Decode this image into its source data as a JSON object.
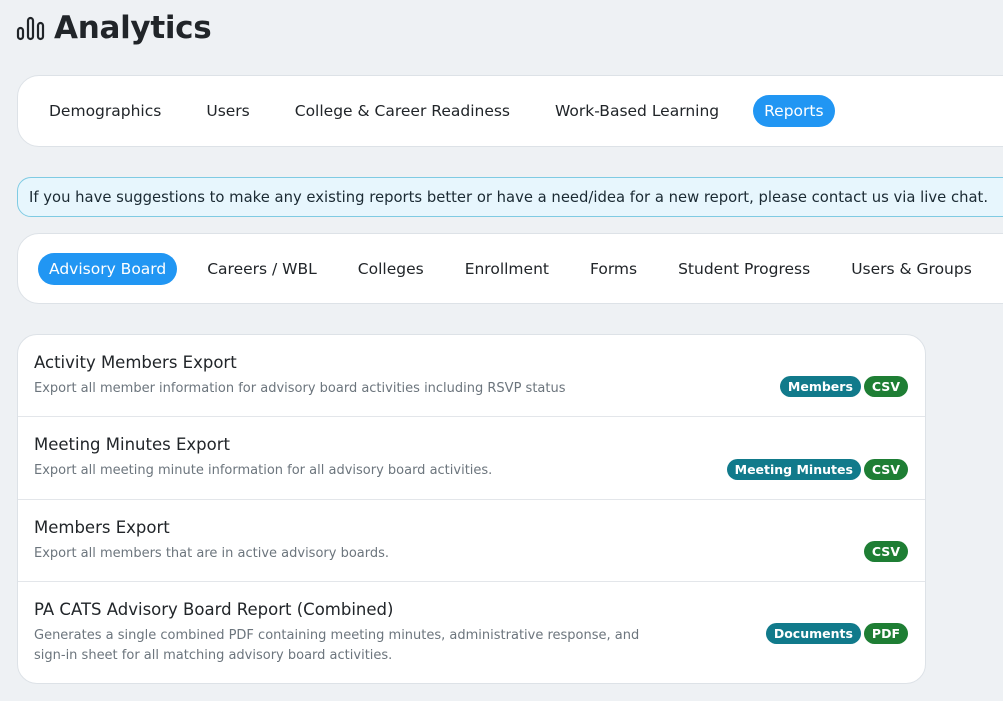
{
  "header": {
    "title": "Analytics",
    "icon": "bar-chart-icon"
  },
  "main_tabs": [
    {
      "label": "Demographics",
      "active": false
    },
    {
      "label": "Users",
      "active": false
    },
    {
      "label": "College & Career Readiness",
      "active": false
    },
    {
      "label": "Work-Based Learning",
      "active": false
    },
    {
      "label": "Reports",
      "active": true
    }
  ],
  "notice": "If you have suggestions to make any existing reports better or have a need/idea for a new report, please contact us via live chat.",
  "report_tabs": [
    {
      "label": "Advisory Board",
      "active": true
    },
    {
      "label": "Careers / WBL",
      "active": false
    },
    {
      "label": "Colleges",
      "active": false
    },
    {
      "label": "Enrollment",
      "active": false
    },
    {
      "label": "Forms",
      "active": false
    },
    {
      "label": "Student Progress",
      "active": false
    },
    {
      "label": "Users & Groups",
      "active": false
    }
  ],
  "reports": [
    {
      "name": "Activity Members Export",
      "description": "Export all member information for advisory board activities including RSVP status",
      "badges": [
        {
          "label": "Members",
          "kind": "category"
        },
        {
          "label": "CSV",
          "kind": "format"
        }
      ]
    },
    {
      "name": "Meeting Minutes Export",
      "description": "Export all meeting minute information for all advisory board activities.",
      "badges": [
        {
          "label": "Meeting Minutes",
          "kind": "category"
        },
        {
          "label": "CSV",
          "kind": "format"
        }
      ]
    },
    {
      "name": "Members Export",
      "description": "Export all members that are in active advisory boards.",
      "badges": [
        {
          "label": "CSV",
          "kind": "format"
        }
      ]
    },
    {
      "name": "PA CATS Advisory Board Report (Combined)",
      "description": "Generates a single combined PDF containing meeting minutes, administrative response, and sign-in sheet for all matching advisory board activities.",
      "badges": [
        {
          "label": "Documents",
          "kind": "category"
        },
        {
          "label": "PDF",
          "kind": "format"
        }
      ]
    }
  ],
  "colors": {
    "accent": "#2196f3",
    "badge_category": "#117a8b",
    "badge_format": "#1e7e34",
    "notice_bg": "#e7f6fd",
    "notice_border": "#7fcbe3"
  }
}
